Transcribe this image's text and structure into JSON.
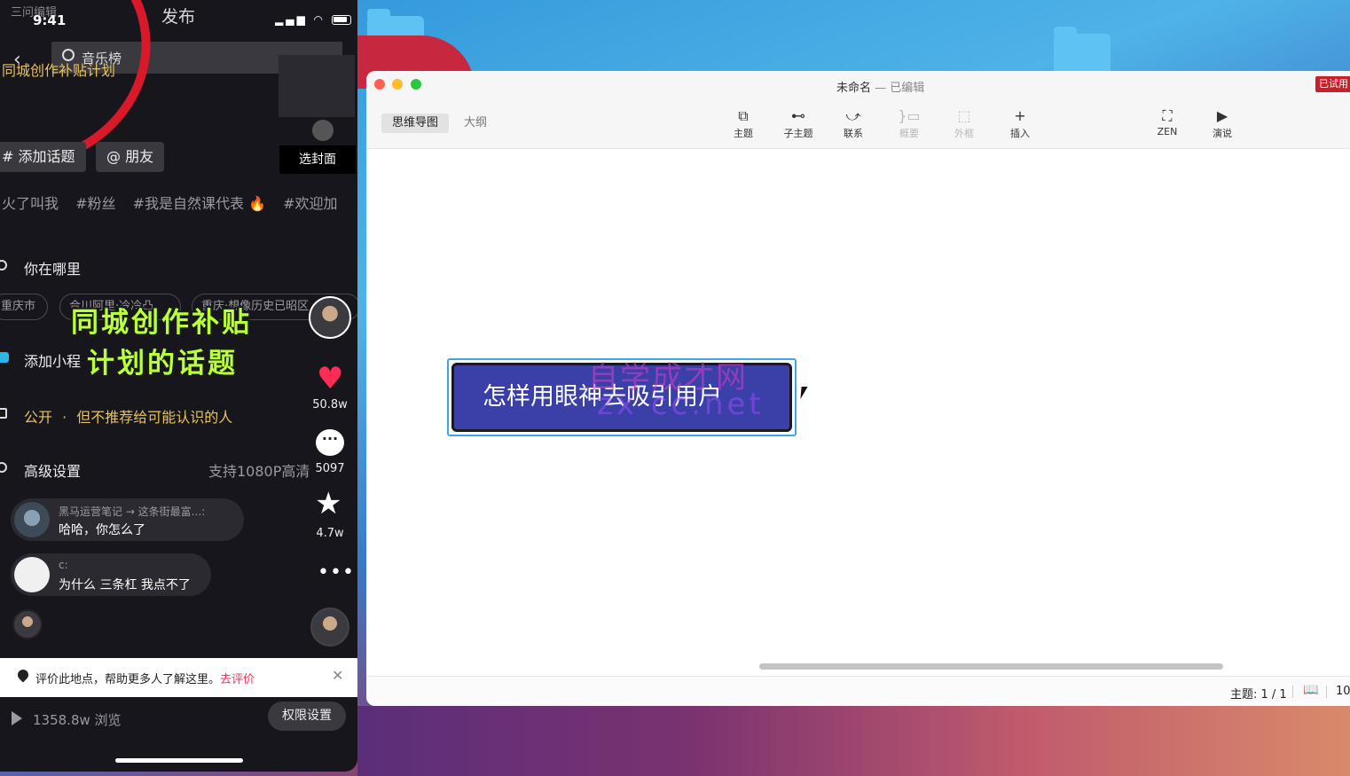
{
  "phone": {
    "status": {
      "time": "9:41",
      "title": "发布",
      "ghost": "三问编辑"
    },
    "search": {
      "label": "音乐榜"
    },
    "subsidy_title": "同城创作补贴计划",
    "cover_button": "选封面",
    "chips": {
      "add": "# 添加话题",
      "friends": "@ 朋友"
    },
    "tags": [
      "火了叫我",
      "#粉丝",
      "#我是自然课代表 🔥",
      "#欢迎加"
    ],
    "location": {
      "label": "你在哪里",
      "chips": [
        "重庆市",
        "合川阿里·冷冷凸",
        "重庆·想像历史已昭区"
      ]
    },
    "mini_program": "添加小程",
    "overlay_line1": "同城创作补贴",
    "overlay_line2": "计划的话题",
    "privacy": {
      "label": "公开",
      "dot": "·",
      "detail": "但不推荐给可能认识的人"
    },
    "advanced": {
      "label": "高级设置",
      "detail": "支持1080P高清"
    },
    "side_counts": {
      "likes": "50.8w",
      "comments": "5097",
      "favorites": "4.7w"
    },
    "comments": [
      {
        "who": "黑马运营笔记 → 这条街最富...:",
        "msg": "哈哈，你怎么了"
      },
      {
        "who": "c:",
        "msg": "为什么 三条杠 我点不了"
      }
    ],
    "notice": {
      "text": "评价此地点，帮助更多人了解这里。",
      "link": "去评价"
    },
    "views": "1358.8w 浏览",
    "permission_button": "权限设置"
  },
  "mindmap": {
    "title": "未命名",
    "title_sub": "— 已编辑",
    "trial_badge": "已试用",
    "view_tabs": [
      "思维导图",
      "大纲"
    ],
    "tools": [
      {
        "label": "主题",
        "icon": "⧉"
      },
      {
        "label": "子主题",
        "icon": "⊷"
      },
      {
        "label": "联系",
        "icon": "⤻"
      },
      {
        "label": "概要",
        "icon": "}▭"
      },
      {
        "label": "外框",
        "icon": "⬚"
      },
      {
        "label": "插入",
        "icon": "+"
      },
      {
        "label": "ZEN",
        "icon": "⛶"
      },
      {
        "label": "演说",
        "icon": "▶"
      }
    ],
    "node_text": "怎样用眼神去吸引用户",
    "watermark_line1": "自学成才网",
    "watermark_line2": "zx cc.net",
    "status": {
      "topics": "主题: 1 / 1",
      "zoom": "10"
    }
  },
  "colors": {
    "accent_red": "#fe2c55",
    "node_fill": "#3b3fa8",
    "overlay_green": "#b9ff3c",
    "circle_red": "#d7192a"
  }
}
